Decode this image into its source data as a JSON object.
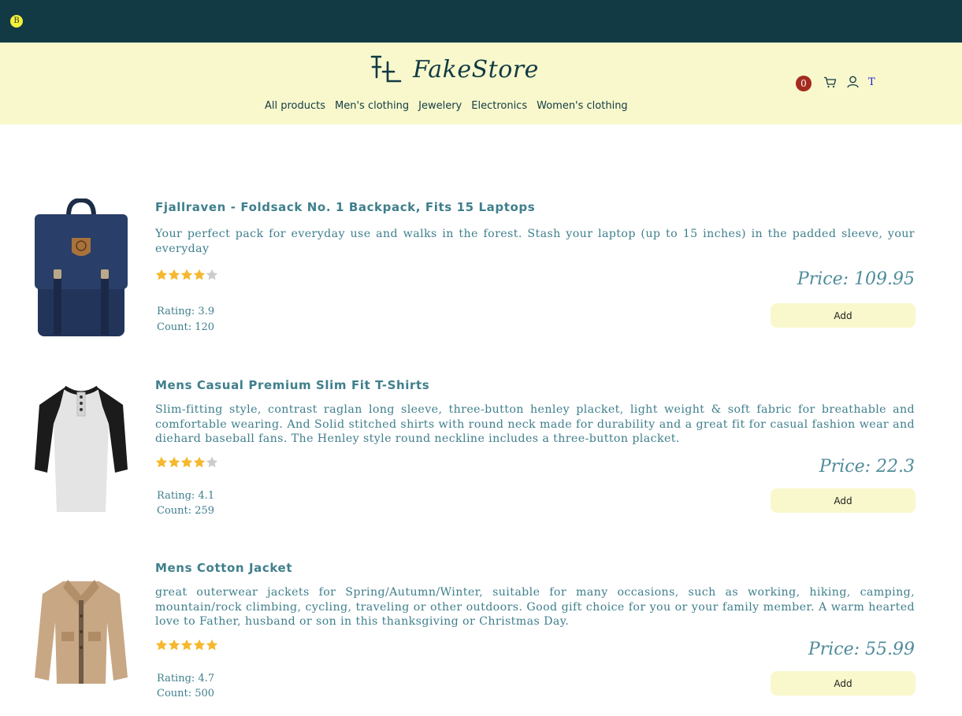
{
  "topbar": {
    "badge_label": "B"
  },
  "header": {
    "logo_text": "FakeStore",
    "nav": [
      "All products",
      "Men's clothing",
      "Jewelery",
      "Electronics",
      "Women's clothing"
    ],
    "cart_count": "0",
    "t_link": "T",
    "icons": [
      "cart-icon",
      "user-icon"
    ]
  },
  "colors": {
    "topbar": "#123a44",
    "header_bg": "#f8f8cc",
    "text_teal": "#3f7f8c",
    "star": "#f5b82e",
    "star_empty": "#cccccc",
    "badge": "#a52a1f"
  },
  "products": [
    {
      "title": "Fjallraven - Foldsack No. 1 Backpack, Fits 15 Laptops",
      "description": "Your perfect pack for everyday use and walks in the forest. Stash your laptop (up to 15 inches) in the padded sleeve, your everyday",
      "price_label": "Price: 109.95",
      "price": 109.95,
      "rating_label": "Rating: 3.9",
      "rating": 3.9,
      "count_label": "Count:  120",
      "count": 120,
      "stars_filled": 4,
      "add_label": "Add"
    },
    {
      "title": "Mens Casual Premium Slim Fit T-Shirts",
      "description": "Slim-fitting style, contrast raglan long sleeve, three-button henley placket, light weight & soft fabric for breathable and comfortable wearing. And Solid stitched shirts with round neck made for durability and a great fit for casual fashion wear and diehard baseball fans. The Henley style round neckline includes a three-button placket.",
      "price_label": "Price: 22.3",
      "price": 22.3,
      "rating_label": "Rating: 4.1",
      "rating": 4.1,
      "count_label": "Count:  259",
      "count": 259,
      "stars_filled": 4,
      "add_label": "Add"
    },
    {
      "title": "Mens Cotton Jacket",
      "description": "great outerwear jackets for Spring/Autumn/Winter, suitable for many occasions, such as working, hiking, camping, mountain/rock climbing, cycling, traveling or other outdoors. Good gift choice for you or your family member. A warm hearted love to Father, husband or son in this thanksgiving or Christmas Day.",
      "price_label": "Price: 55.99",
      "price": 55.99,
      "rating_label": "Rating: 4.7",
      "rating": 4.7,
      "count_label": "Count:  500",
      "count": 500,
      "stars_filled": 5,
      "add_label": "Add"
    }
  ]
}
